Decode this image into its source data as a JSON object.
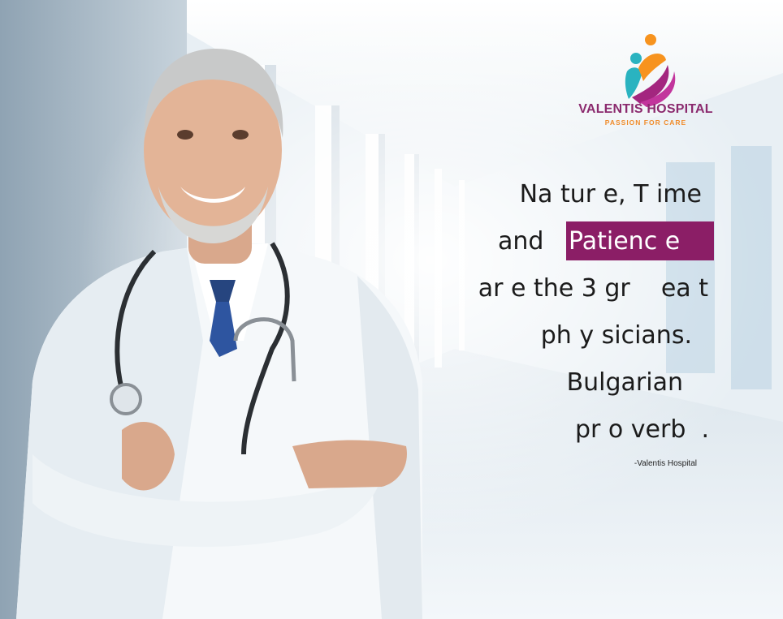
{
  "brand": {
    "name": "VALENTIS HOSPITAL",
    "tagline": "PASSION FOR CARE"
  },
  "quote": {
    "line1": "Na tur e, T ime",
    "line2_prefix": "and ",
    "line2_highlight": "Patienc e",
    "line3": "ar e the 3 gr    ea t",
    "line4": "ph y sicians.",
    "line5": "Bulgarian",
    "line6": "pr o verb  ."
  },
  "attribution": "-Valentis Hospital",
  "colors": {
    "highlight": "#8b1e66",
    "brand": "#8b2a6e",
    "tagline": "#f08c2b",
    "logo_teal": "#2ab3c0",
    "logo_orange": "#f7931e"
  },
  "icons": {
    "logo": "hands-holding-people-icon"
  }
}
